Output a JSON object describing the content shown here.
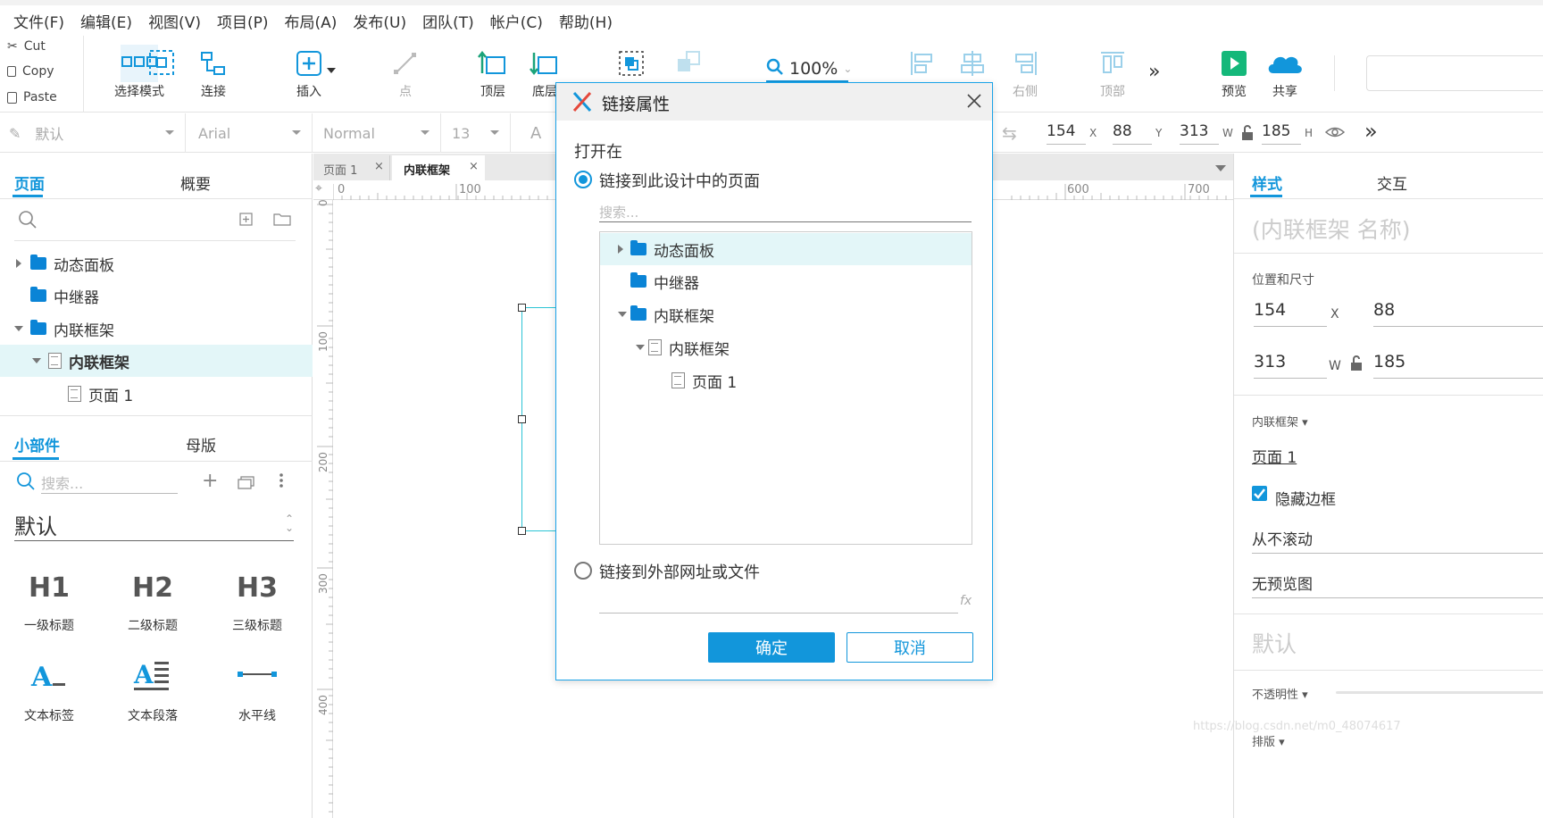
{
  "menubar": {
    "items": [
      "文件(F)",
      "编辑(E)",
      "视图(V)",
      "项目(P)",
      "布局(A)",
      "发布(U)",
      "团队(T)",
      "帐户(C)",
      "帮助(H)"
    ]
  },
  "toolbar": {
    "cut": "Cut",
    "copy": "Copy",
    "paste": "Paste",
    "select_mode": "选择模式",
    "connect": "连接",
    "insert": "插入",
    "point": "点",
    "top_layer": "顶层",
    "bottom_layer": "底层",
    "zoom": "100%",
    "right": "右侧",
    "top": "顶部",
    "preview": "预览",
    "share": "共享"
  },
  "formatbar": {
    "style": "默认",
    "font": "Arial",
    "weight": "Normal",
    "size": "13",
    "letter": "A",
    "x": "154",
    "x_label": "X",
    "y": "88",
    "y_label": "Y",
    "w": "313",
    "w_label": "W",
    "h": "185",
    "h_label": "H"
  },
  "left_panel": {
    "tab_pages": "页面",
    "tab_outline": "概要",
    "tree": [
      {
        "label": "动态面板",
        "type": "folder"
      },
      {
        "label": "中继器",
        "type": "folder"
      },
      {
        "label": "内联框架",
        "type": "folder"
      },
      {
        "label": "内联框架",
        "type": "page"
      },
      {
        "label": "页面 1",
        "type": "page"
      }
    ],
    "tab_widgets": "小部件",
    "tab_masters": "母版",
    "search_placeholder": "搜索...",
    "library": "默认",
    "widgets": [
      {
        "icon": "H1",
        "label": "一级标题"
      },
      {
        "icon": "H2",
        "label": "二级标题"
      },
      {
        "icon": "H3",
        "label": "三级标题"
      },
      {
        "icon": "text-label-icon",
        "label": "文本标签"
      },
      {
        "icon": "paragraph-icon",
        "label": "文本段落"
      },
      {
        "icon": "horizontal-line-icon",
        "label": "水平线"
      }
    ]
  },
  "canvas": {
    "tabs": [
      "页面 1",
      "内联框架"
    ],
    "ruler_h": [
      "0",
      "100",
      "600",
      "700"
    ],
    "ruler_v": [
      "0",
      "100",
      "200",
      "300",
      "400"
    ]
  },
  "right_panel": {
    "tab_style": "样式",
    "tab_interact": "交互",
    "name_placeholder": "(内联框架 名称)",
    "section_pos": "位置和尺寸",
    "x": "154",
    "y": "88",
    "w": "313",
    "h": "185",
    "x_label": "X",
    "w_label": "W",
    "frame_label": "内联框架 ▾",
    "frame_link": "页面 1",
    "hide_border": "隐藏边框",
    "scroll": "从不滚动",
    "preview": "无预览图",
    "style_default": "默认",
    "opacity": "不透明性 ▾",
    "arrange": "排版 ▾",
    "watermark": "https://blog.csdn.net/m0_48074617"
  },
  "dialog": {
    "title": "链接属性",
    "open_in": "打开在",
    "option_page": "链接到此设计中的页面",
    "search_placeholder": "搜索...",
    "tree": [
      {
        "label": "动态面板",
        "type": "folder"
      },
      {
        "label": "中继器",
        "type": "folder"
      },
      {
        "label": "内联框架",
        "type": "folder"
      },
      {
        "label": "内联框架",
        "type": "page"
      },
      {
        "label": "页面 1",
        "type": "page"
      }
    ],
    "option_url": "链接到外部网址或文件",
    "fx": "fx",
    "ok": "确定",
    "cancel": "取消"
  },
  "colors": {
    "accent": "#1296db",
    "dialog_border": "#1aa3e8",
    "selection_row": "#e3f6f8"
  }
}
